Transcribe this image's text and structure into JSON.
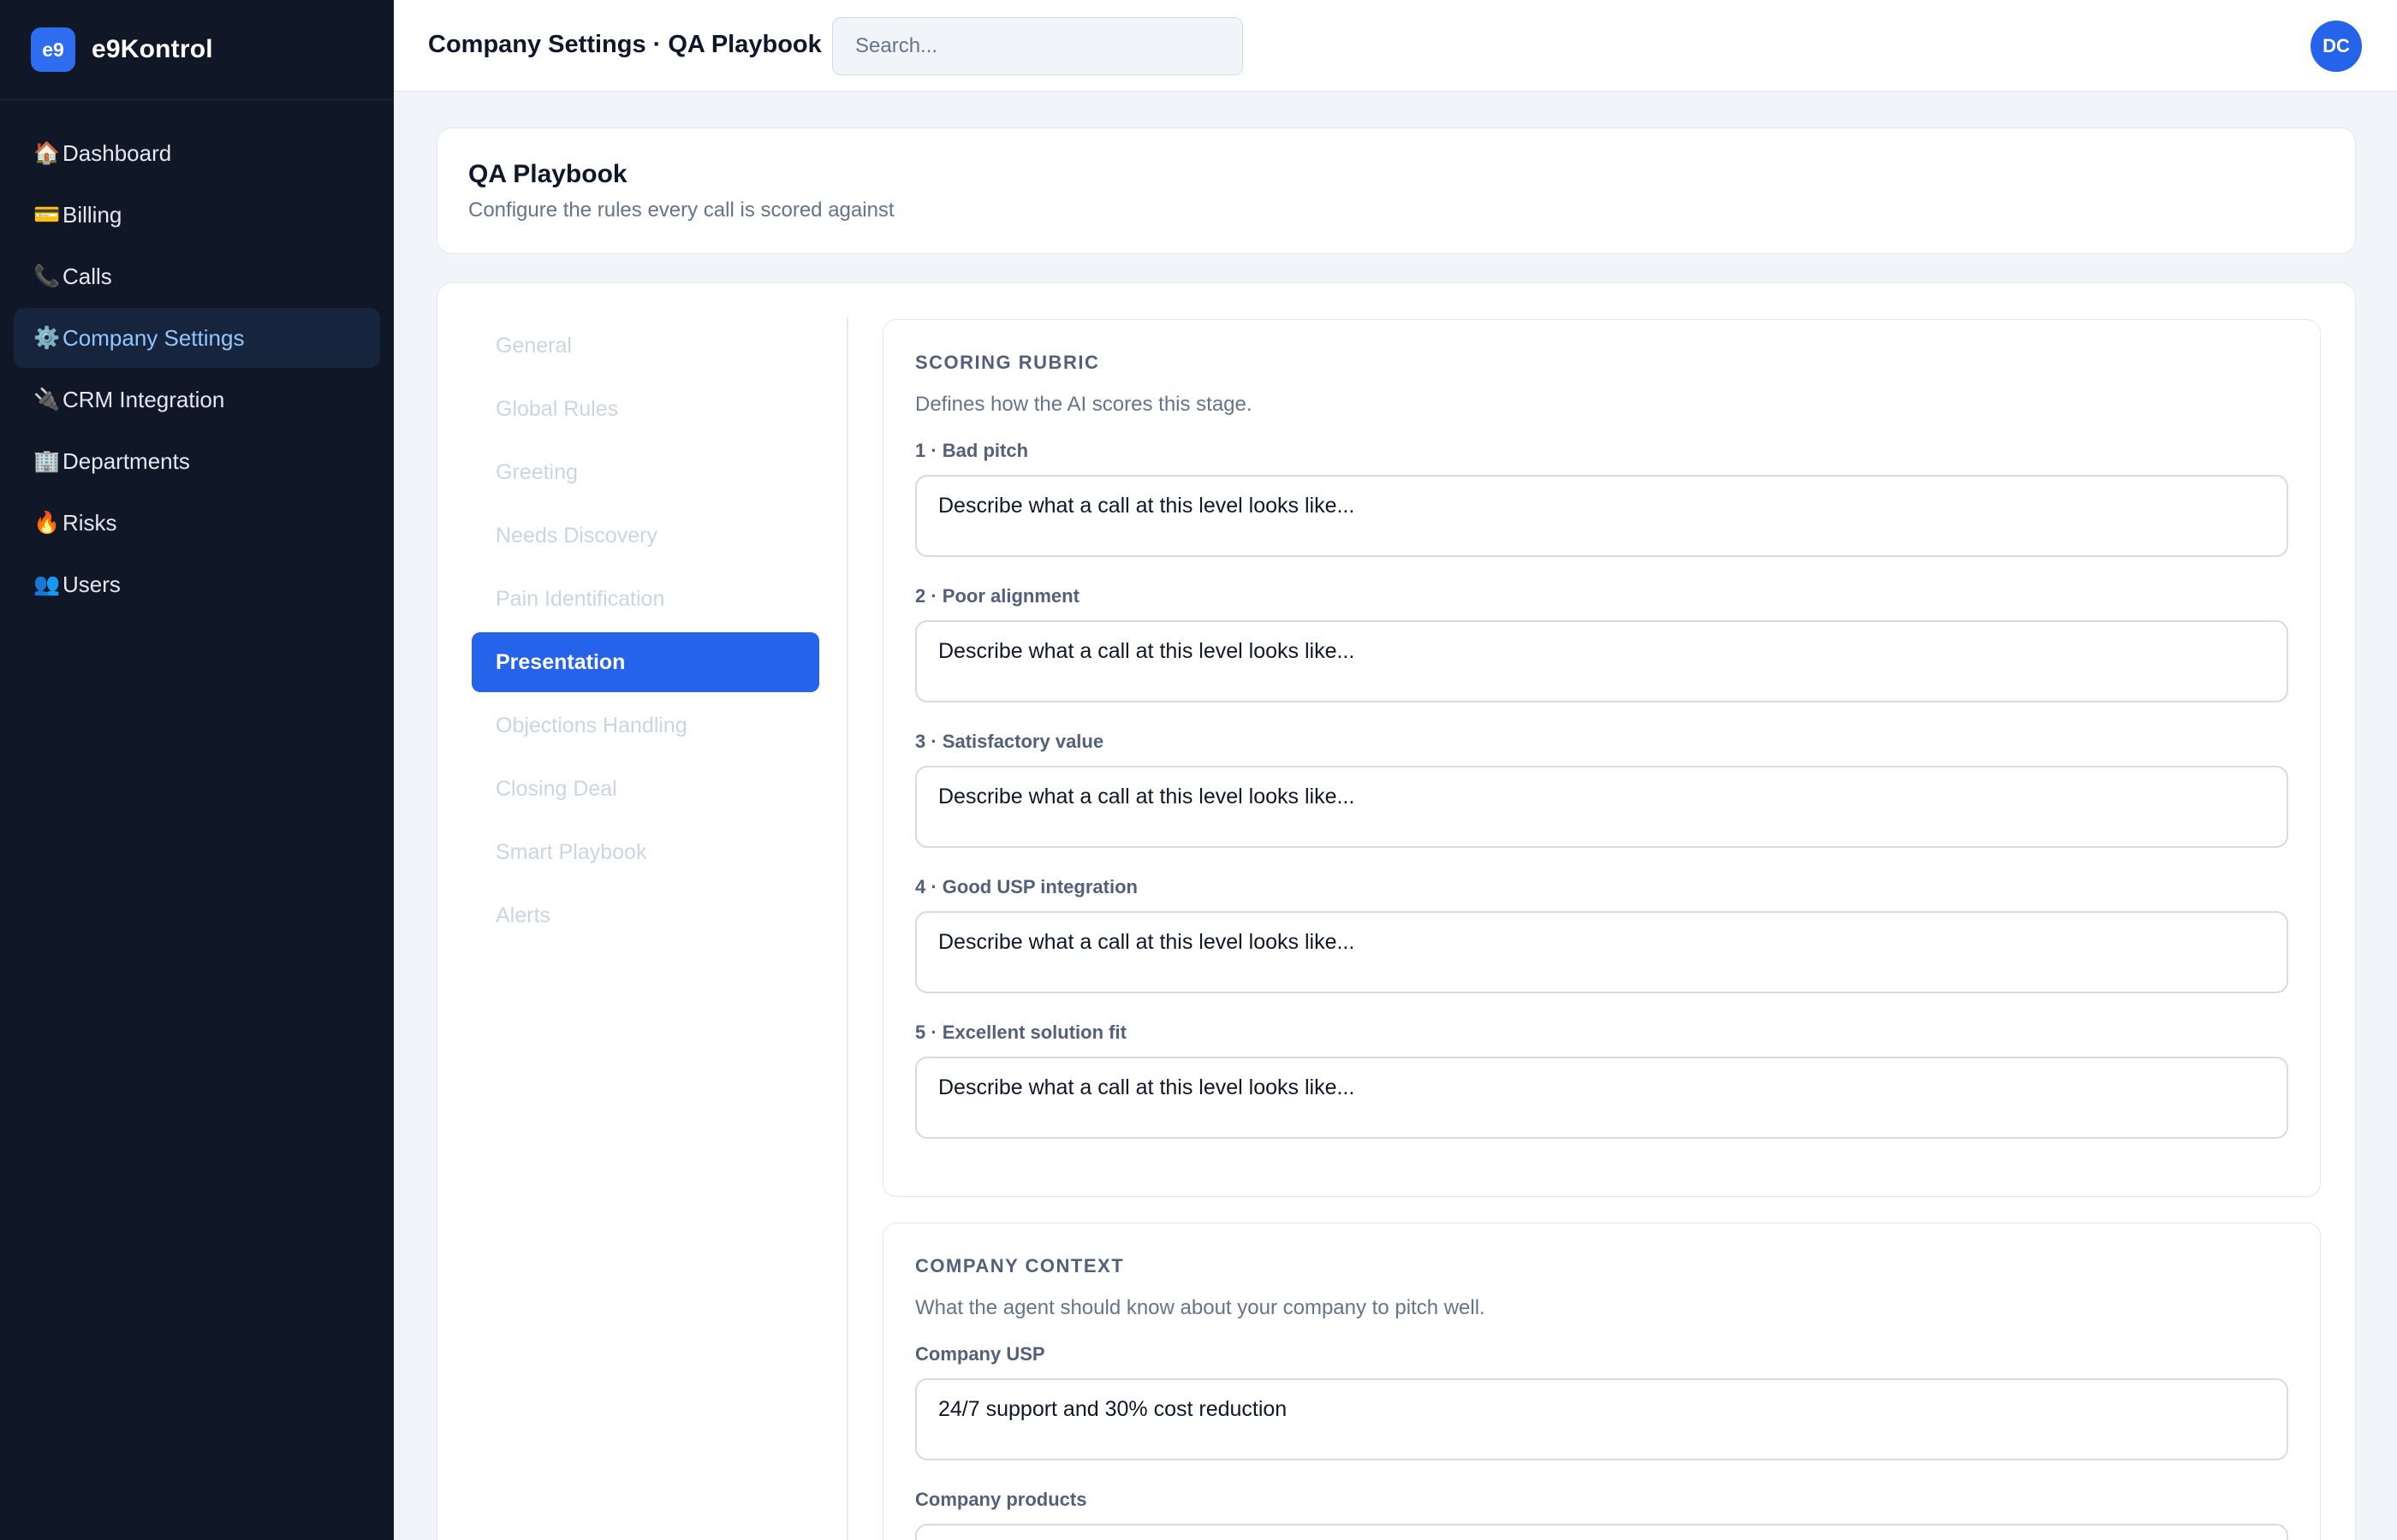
{
  "brand": {
    "logo": "e9",
    "name": "e9Kontrol"
  },
  "sidebar": {
    "items": [
      {
        "icon": "🏠",
        "label": "Dashboard"
      },
      {
        "icon": "💳",
        "label": "Billing"
      },
      {
        "icon": "📞",
        "label": "Calls"
      },
      {
        "icon": "⚙️",
        "label": "Company Settings"
      },
      {
        "icon": "🔌",
        "label": "CRM Integration"
      },
      {
        "icon": "🏢",
        "label": "Departments"
      },
      {
        "icon": "🔥",
        "label": "Risks"
      },
      {
        "icon": "👥",
        "label": "Users"
      }
    ],
    "active_item": "Company Settings"
  },
  "header": {
    "title": "Company Settings · QA Playbook",
    "search_placeholder": "Search...",
    "avatar_initials": "DC"
  },
  "page": {
    "title": "QA Playbook",
    "subtitle": "Configure the rules every call is scored against"
  },
  "stages": {
    "items": [
      "General",
      "Global Rules",
      "Greeting",
      "Needs Discovery",
      "Pain Identification",
      "Presentation",
      "Objections Handling",
      "Closing Deal",
      "Smart Playbook",
      "Alerts"
    ],
    "active": "Presentation"
  },
  "scoring_rubric": {
    "title": "SCORING RUBRIC",
    "description": "Defines how the AI scores this stage.",
    "levels": [
      {
        "label": "1 · Bad pitch",
        "value": "Describe what a call at this level looks like..."
      },
      {
        "label": "2 · Poor alignment",
        "value": "Describe what a call at this level looks like..."
      },
      {
        "label": "3 · Satisfactory value",
        "value": "Describe what a call at this level looks like..."
      },
      {
        "label": "4 · Good USP integration",
        "value": "Describe what a call at this level looks like..."
      },
      {
        "label": "5 · Excellent solution fit",
        "value": "Describe what a call at this level looks like..."
      }
    ]
  },
  "company_context": {
    "title": "COMPANY CONTEXT",
    "description": "What the agent should know about your company to pitch well.",
    "fields": [
      {
        "label": "Company USP",
        "value": "24/7 support and 30% cost reduction"
      },
      {
        "label": "Company products",
        "value": ""
      }
    ]
  },
  "colors": {
    "sidebar_bg": "#101828",
    "accent": "#2563eb",
    "active_nav_text": "#93c5fd",
    "page_bg": "#f1f4f9"
  }
}
